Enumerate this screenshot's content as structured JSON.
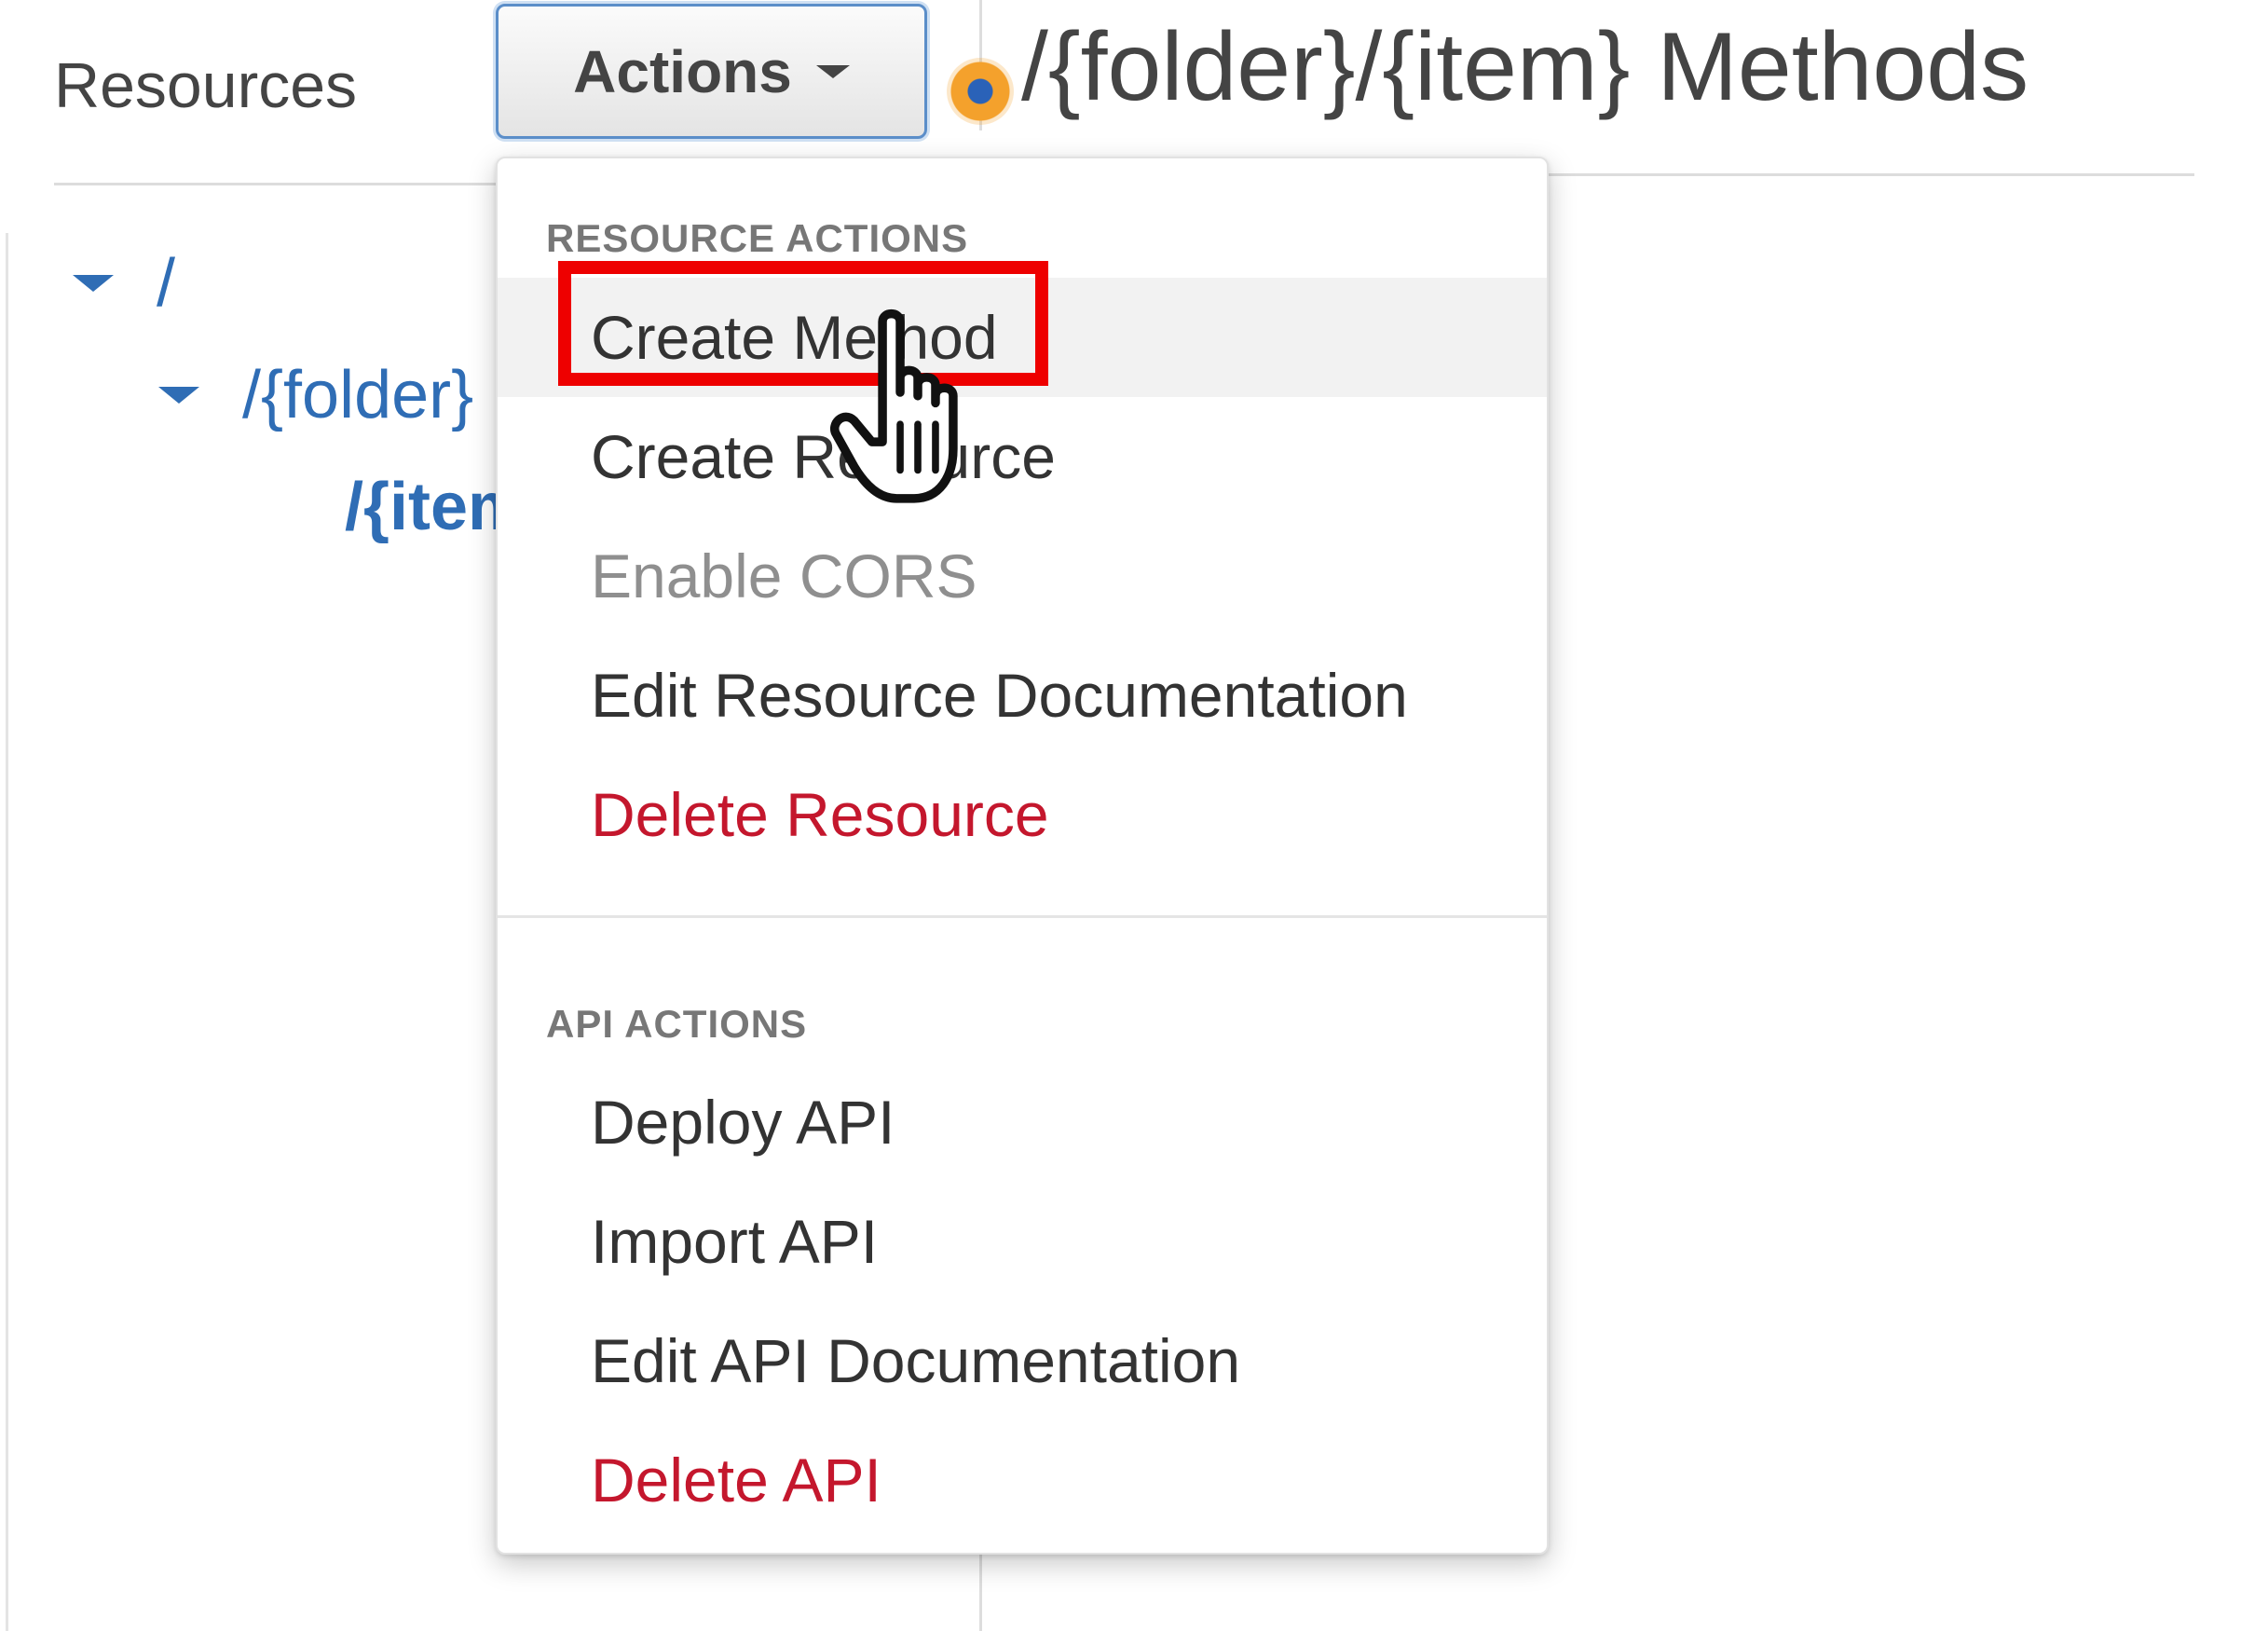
{
  "left_panel": {
    "title": "Resources"
  },
  "actions_button": {
    "label": "Actions"
  },
  "header": {
    "resource_path_title": "/{folder}/{item} Methods",
    "status_color": "#f4a12c"
  },
  "tree": {
    "items": [
      {
        "label": "/",
        "expanded": true
      },
      {
        "label": "/{folder}",
        "expanded": true
      },
      {
        "label": "/{item}",
        "selected": true
      }
    ]
  },
  "menu": {
    "resource_actions_header": "RESOURCE ACTIONS",
    "resource_actions": [
      {
        "label": "Create Method",
        "state": "hover"
      },
      {
        "label": "Create Resource",
        "state": "normal"
      },
      {
        "label": "Enable CORS",
        "state": "disabled"
      },
      {
        "label": "Edit Resource Documentation",
        "state": "normal"
      },
      {
        "label": "Delete Resource",
        "state": "danger"
      }
    ],
    "api_actions_header": "API ACTIONS",
    "api_actions": [
      {
        "label": "Deploy API",
        "state": "normal"
      },
      {
        "label": "Import API",
        "state": "normal"
      },
      {
        "label": "Edit API Documentation",
        "state": "normal"
      },
      {
        "label": "Delete API",
        "state": "danger"
      }
    ]
  },
  "colors": {
    "link_blue": "#2f6db5",
    "danger_red": "#c4172d",
    "highlight_red": "#ee0000",
    "button_border": "#5b8ec9"
  },
  "icons": {
    "cursor": "hand-pointer-icon",
    "actions_caret": "caret-down-icon",
    "tree_toggle": "triangle-down-icon"
  }
}
